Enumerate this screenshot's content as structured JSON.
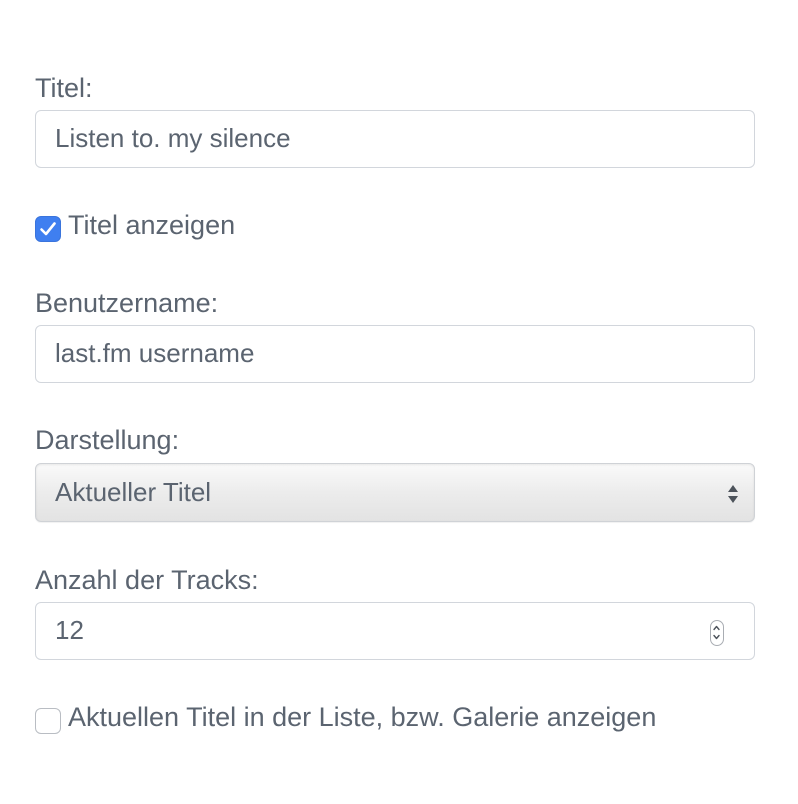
{
  "form": {
    "title_label": "Titel:",
    "title_value": "Listen to. my silence",
    "show_title_label": "Titel anzeigen",
    "show_title_checked": true,
    "username_label": "Benutzername:",
    "username_placeholder": "last.fm username",
    "display_label": "Darstellung:",
    "display_selected": "Aktueller Titel",
    "tracks_label": "Anzahl der Tracks:",
    "tracks_value": "12",
    "show_current_label": "Aktuellen Titel in der Liste, bzw. Galerie anzeigen",
    "show_current_checked": false
  },
  "colors": {
    "text": "#5b6470",
    "border": "#d2d6dc",
    "checkbox_accent": "#3f7ff0"
  },
  "icons": {
    "checkmark": "checkmark-icon",
    "select_arrows": "select-arrows-icon",
    "stepper": "number-stepper-icon"
  }
}
